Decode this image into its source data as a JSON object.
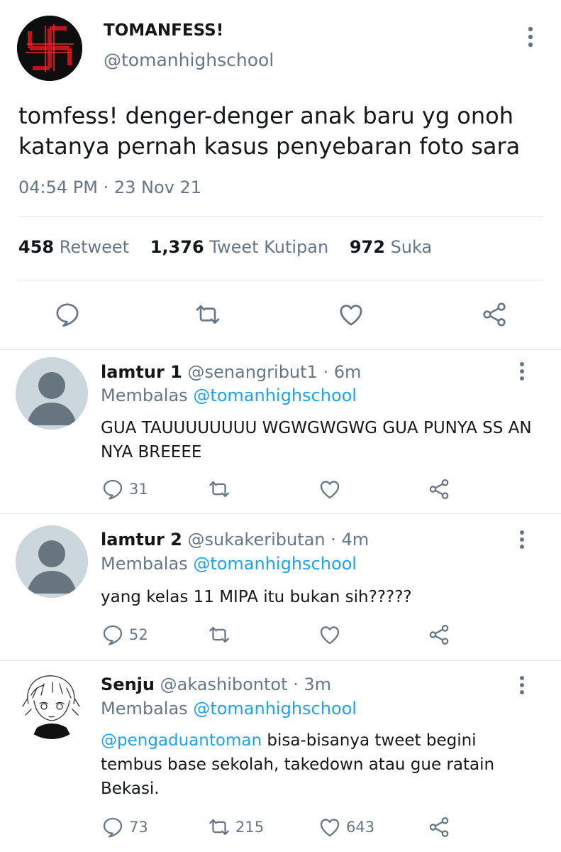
{
  "main": {
    "author_name": "TOMANFESS!",
    "author_handle": "@tomanhighschool",
    "text": "tomfess! denger-denger anak baru yg onoh katanya pernah kasus penyebaran foto sara",
    "time": "04:54 PM",
    "date": "23 Nov 21",
    "retweets_count": "458",
    "retweets_label": "Retweet",
    "quotes_count": "1,376",
    "quotes_label": "Tweet Kutipan",
    "likes_count": "972",
    "likes_label": "Suka"
  },
  "replies": [
    {
      "name": "lamtur 1",
      "handle": "@senangribut1",
      "time": "6m",
      "replying_prefix": "Membalas",
      "replying_to": "@tomanhighschool",
      "text": "GUA TAUUUUUUUU WGWGWGWG GUA PUNYA SS AN NYA BREEEE",
      "reply_count": "31",
      "retweet_count": "",
      "like_count": ""
    },
    {
      "name": "lamtur 2",
      "handle": "@sukakeributan",
      "time": "4m",
      "replying_prefix": "Membalas",
      "replying_to": "@tomanhighschool",
      "text": "yang kelas 11 MIPA itu bukan sih?????",
      "reply_count": "52",
      "retweet_count": "",
      "like_count": ""
    },
    {
      "name": "Senju",
      "handle": "@akashibontot",
      "time": "3m",
      "replying_prefix": "Membalas",
      "replying_to": "@tomanhighschool",
      "mention": "@pengaduantoman",
      "text": " bisa-bisanya tweet begini tembus base sekolah, takedown atau gue ratain Bekasi.",
      "reply_count": "73",
      "retweet_count": "215",
      "like_count": "643"
    }
  ],
  "colors": {
    "text": "#14171a",
    "secondary": "#657786",
    "link": "#1da1f2",
    "divider": "#e1e8ed",
    "icon": "#657786",
    "logo_red": "#c0141c"
  },
  "icons": [
    "more-icon",
    "reply-icon",
    "retweet-icon",
    "like-icon",
    "share-icon",
    "default-avatar-icon",
    "anime-avatar"
  ]
}
